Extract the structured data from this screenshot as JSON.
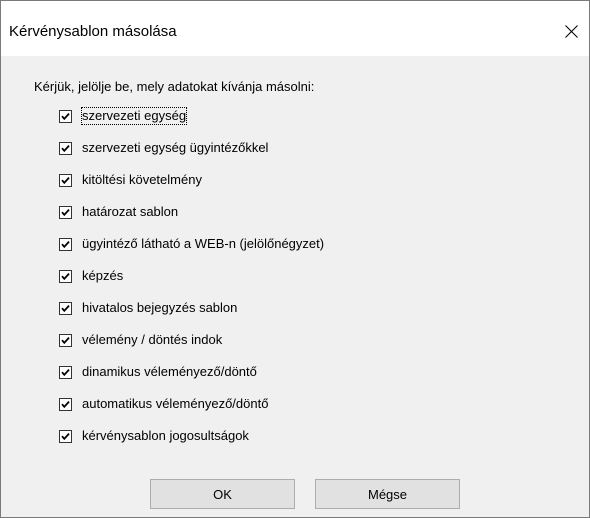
{
  "window": {
    "title": "Kérvénysablon másolása",
    "close_icon": "close-icon"
  },
  "prompt": "Kérjük, jelölje be, mely adatokat kívánja másolni:",
  "options": [
    {
      "label": "szervezeti egység",
      "checked": true
    },
    {
      "label": "szervezeti egység ügyintézőkkel",
      "checked": true
    },
    {
      "label": "kitöltési követelmény",
      "checked": true
    },
    {
      "label": "határozat sablon",
      "checked": true
    },
    {
      "label": "ügyintéző látható a WEB-n (jelölőnégyzet)",
      "checked": true
    },
    {
      "label": "képzés",
      "checked": true
    },
    {
      "label": "hivatalos bejegyzés sablon",
      "checked": true
    },
    {
      "label": "vélemény / döntés indok",
      "checked": true
    },
    {
      "label": "dinamikus véleményező/döntő",
      "checked": true
    },
    {
      "label": "automatikus véleményező/döntő",
      "checked": true
    },
    {
      "label": "kérvénysablon jogosultságok",
      "checked": true
    }
  ],
  "buttons": {
    "ok": "OK",
    "cancel": "Mégse"
  }
}
